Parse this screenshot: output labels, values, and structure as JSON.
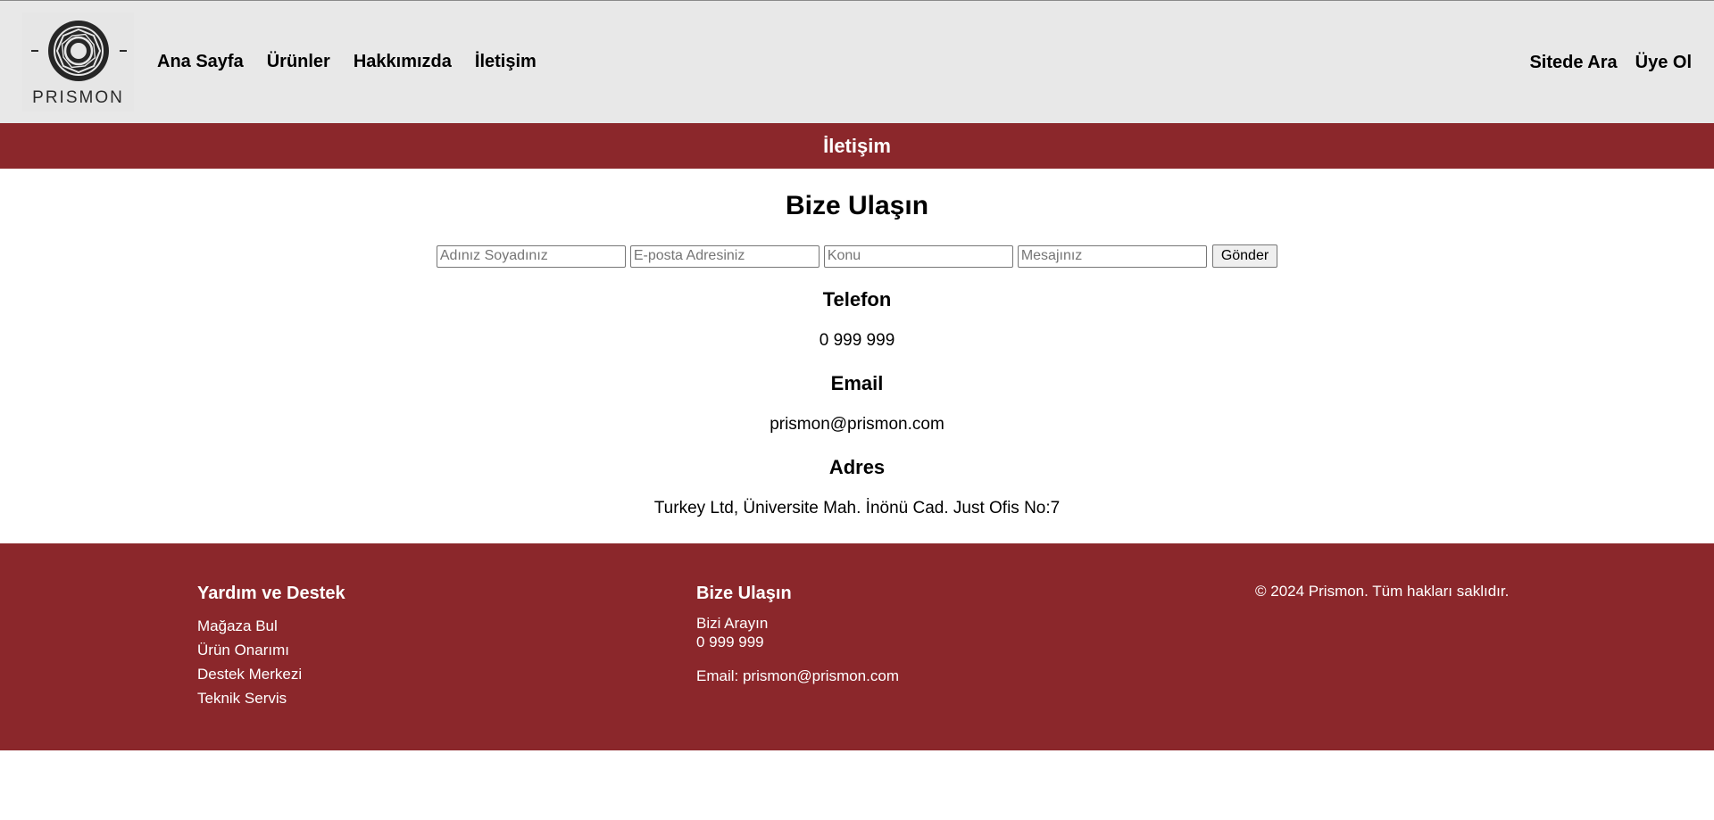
{
  "header": {
    "logo_text": "PRISMON",
    "nav_left": [
      "Ana Sayfa",
      "Ürünler",
      "Hakkımızda",
      "İletişim"
    ],
    "nav_right": [
      "Sitede Ara",
      "Üye Ol"
    ]
  },
  "banner": {
    "title": "İletişim"
  },
  "main": {
    "title": "Bize Ulaşın",
    "form": {
      "name_placeholder": "Adınız Soyadınız",
      "email_placeholder": "E-posta Adresiniz",
      "subject_placeholder": "Konu",
      "message_placeholder": "Mesajınız",
      "submit_label": "Gönder"
    },
    "phone_heading": "Telefon",
    "phone_value": "0 999 999",
    "email_heading": "Email",
    "email_value": "prismon@prismon.com",
    "address_heading": "Adres",
    "address_value": "Turkey Ltd, Üniversite Mah. İnönü Cad. Just Ofis No:7"
  },
  "footer": {
    "support_heading": "Yardım ve Destek",
    "support_links": [
      "Mağaza Bul",
      "Ürün Onarımı",
      "Destek Merkezi",
      "Teknik Servis"
    ],
    "contact_heading": "Bize Ulaşın",
    "call_label": "Bizi Arayın",
    "call_number": "0 999 999",
    "email_line": "Email: prismon@prismon.com",
    "copyright": "© 2024 Prismon. Tüm hakları saklıdır."
  },
  "colors": {
    "header_bg": "#e8e8e8",
    "accent": "#8b272b",
    "text": "#000000",
    "footer_text": "#ffffff"
  },
  "icons": {
    "logo": "prismon-logo-icon"
  }
}
